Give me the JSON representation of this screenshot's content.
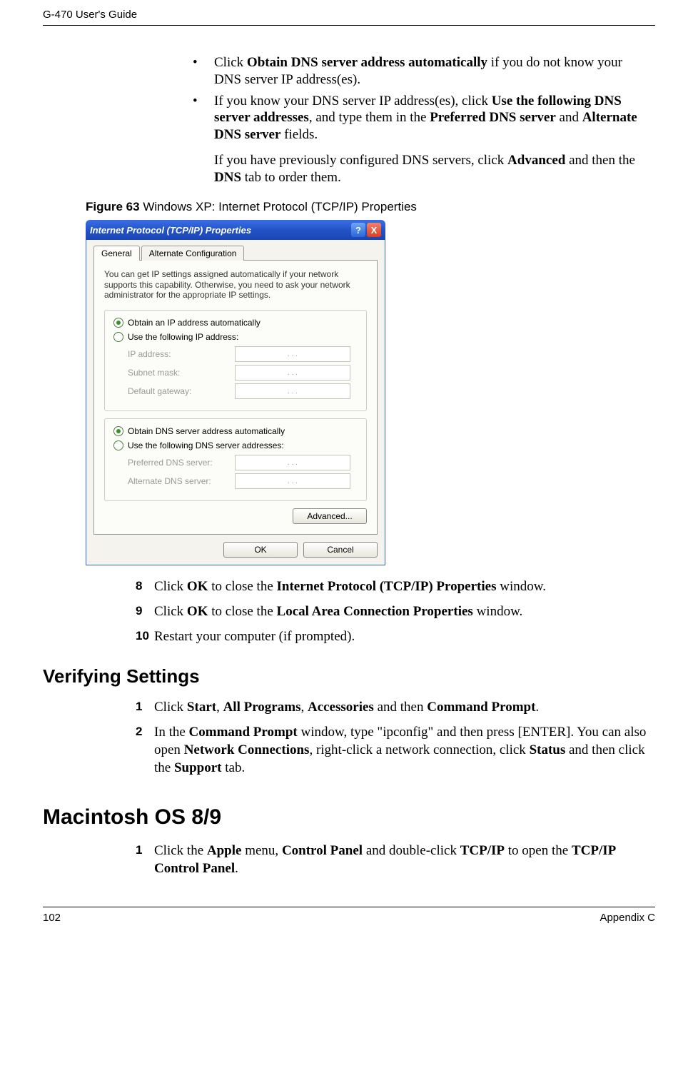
{
  "header": {
    "left": "G-470 User's Guide"
  },
  "footer": {
    "left": "102",
    "right": "Appendix C"
  },
  "bullets": {
    "b1_pre": "Click ",
    "b1_bold": "Obtain DNS server address automatically",
    "b1_post": " if you do not know your DNS server IP address(es).",
    "b2_pre": "If you know your DNS server IP address(es), click ",
    "b2_bold1": "Use the following DNS server addresses",
    "b2_mid1": ", and type them in the ",
    "b2_bold2": "Preferred DNS server",
    "b2_mid2": " and ",
    "b2_bold3": "Alternate DNS server",
    "b2_post": " fields."
  },
  "post_bullet": {
    "pre": "If you have previously configured DNS servers, click ",
    "bold1": "Advanced",
    "mid": " and then the ",
    "bold2": "DNS",
    "post": " tab to order them."
  },
  "figure": {
    "label": "Figure 63",
    "caption": "   Windows XP: Internet Protocol (TCP/IP) Properties"
  },
  "dialog": {
    "title": "Internet Protocol (TCP/IP) Properties",
    "help": "?",
    "close": "X",
    "tab1": "General",
    "tab2": "Alternate Configuration",
    "desc": "You can get IP settings assigned automatically if your network supports this capability. Otherwise, you need to ask your network administrator for the appropriate IP settings.",
    "r1": "Obtain an IP address automatically",
    "r2": "Use the following IP address:",
    "f_ip": "IP address:",
    "f_mask": "Subnet mask:",
    "f_gw": "Default gateway:",
    "r3": "Obtain DNS server address automatically",
    "r4": "Use the following DNS server addresses:",
    "f_pdns": "Preferred DNS server:",
    "f_adns": "Alternate DNS server:",
    "advanced": "Advanced...",
    "ok": "OK",
    "cancel": "Cancel",
    "ipdots": ".   .   ."
  },
  "steps": {
    "n8": "8",
    "s8_pre": "Click ",
    "s8_b1": "OK",
    "s8_mid": " to close the ",
    "s8_b2": "Internet Protocol (TCP/IP) Properties",
    "s8_post": " window.",
    "n9": "9",
    "s9_pre": "Click ",
    "s9_b1": "OK",
    "s9_mid": " to close the ",
    "s9_b2": "Local Area Connection Properties",
    "s9_post": " window.",
    "n10": "10",
    "s10": "Restart your computer (if prompted)."
  },
  "verify": {
    "heading": "Verifying Settings",
    "n1": "1",
    "s1_pre": "Click ",
    "s1_b1": "Start",
    "s1_c1": ", ",
    "s1_b2": "All Programs",
    "s1_c2": ", ",
    "s1_b3": "Accessories",
    "s1_mid": " and then ",
    "s1_b4": "Command Prompt",
    "s1_post": ".",
    "n2": "2",
    "s2_pre": "In the ",
    "s2_b1": "Command Prompt",
    "s2_mid1": " window, type \"ipconfig\" and then press [ENTER]. You can also open ",
    "s2_b2": "Network Connections",
    "s2_mid2": ", right-click a network connection, click ",
    "s2_b3": "Status",
    "s2_mid3": " and then click the ",
    "s2_b4": "Support",
    "s2_post": " tab."
  },
  "mac": {
    "heading": "Macintosh OS 8/9",
    "n1": "1",
    "s1_pre": "Click the ",
    "s1_b1": "Apple",
    "s1_mid1": " menu, ",
    "s1_b2": "Control Panel",
    "s1_mid2": " and double-click ",
    "s1_b3": "TCP/IP",
    "s1_mid3": " to open the ",
    "s1_b4": "TCP/IP Control Panel",
    "s1_post": "."
  }
}
